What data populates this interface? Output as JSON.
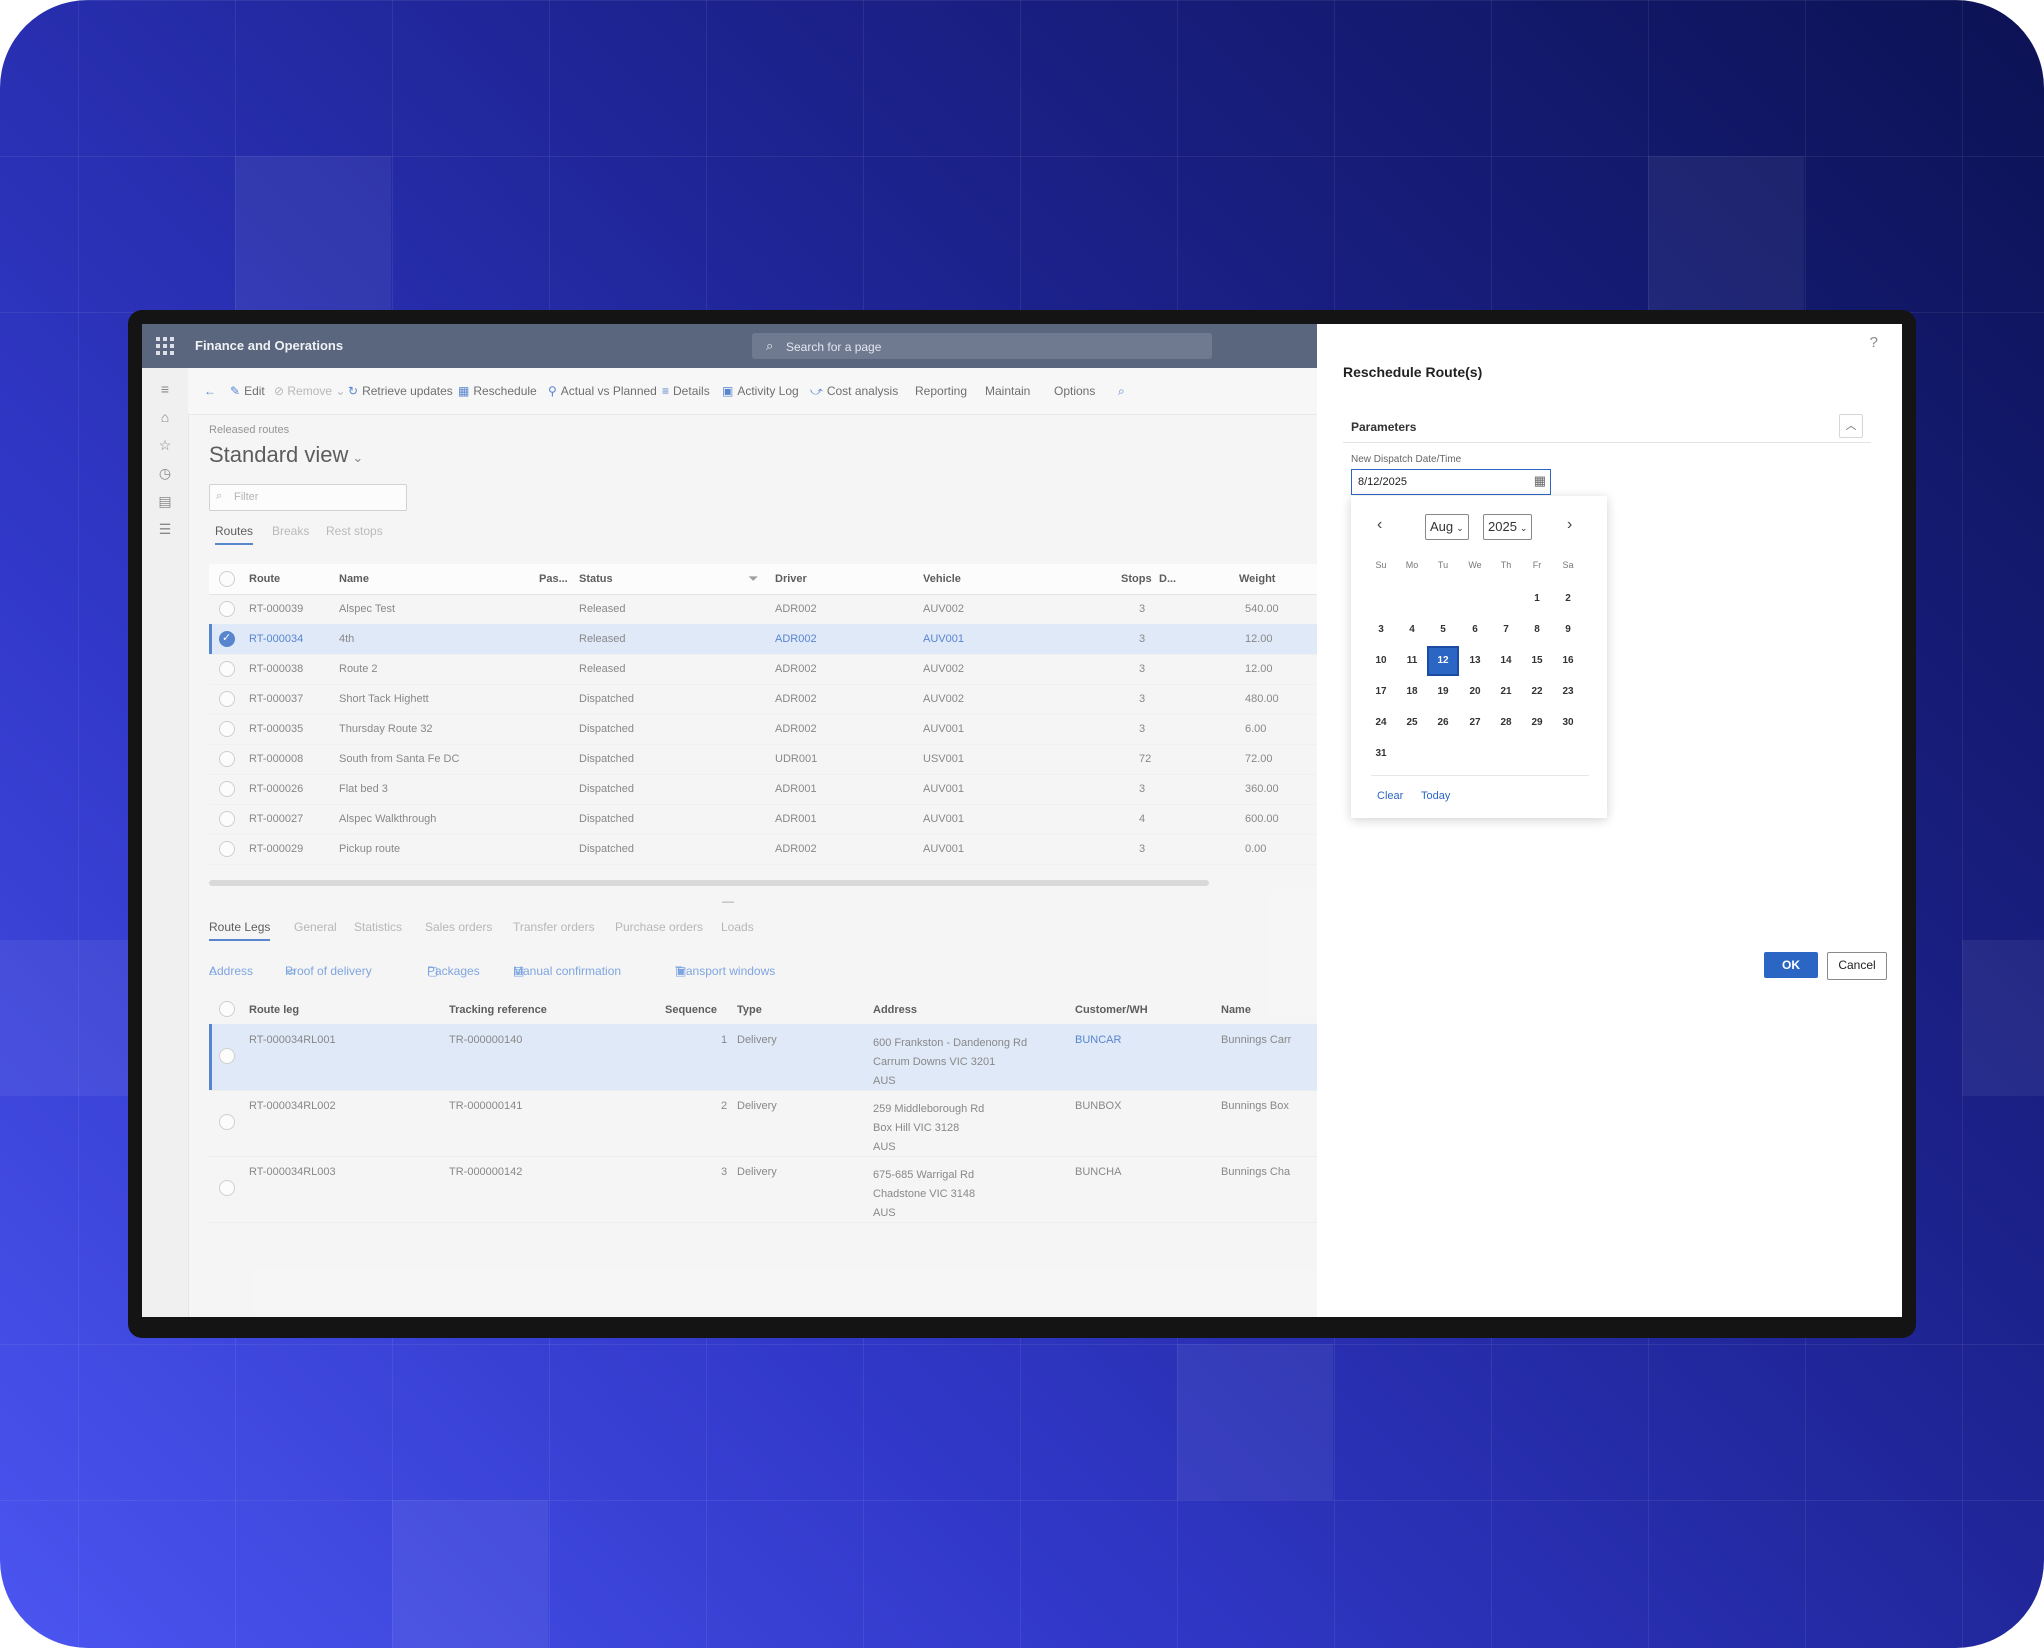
{
  "app": {
    "title": "Finance and Operations",
    "search_placeholder": "Search for a page"
  },
  "toolbar": {
    "edit": "Edit",
    "remove": "Remove",
    "retrieve_updates": "Retrieve updates",
    "reschedule": "Reschedule",
    "actual_vs_planned": "Actual vs Planned",
    "details": "Details",
    "activity_log": "Activity Log",
    "cost_analysis": "Cost analysis",
    "reporting": "Reporting",
    "maintain": "Maintain",
    "options": "Options"
  },
  "page": {
    "breadcrumb": "Released routes",
    "title": "Standard view",
    "filter_placeholder": "Filter"
  },
  "tabs_top": [
    "Routes",
    "Breaks",
    "Rest stops"
  ],
  "routes_grid": {
    "headers": [
      "Route",
      "Name",
      "Pas...",
      "Status",
      "Driver",
      "Vehicle",
      "Stops",
      "D...",
      "Weight"
    ],
    "rows": [
      {
        "route": "RT-000039",
        "name": "Alspec Test",
        "status": "Released",
        "driver": "ADR002",
        "vehicle": "AUV002",
        "stops": "3",
        "weight": "540.00"
      },
      {
        "route": "RT-000034",
        "name": "4th",
        "status": "Released",
        "driver": "ADR002",
        "vehicle": "AUV001",
        "stops": "3",
        "weight": "12.00"
      },
      {
        "route": "RT-000038",
        "name": "Route 2",
        "status": "Released",
        "driver": "ADR002",
        "vehicle": "AUV002",
        "stops": "3",
        "weight": "12.00"
      },
      {
        "route": "RT-000037",
        "name": "Short Tack Highett",
        "status": "Dispatched",
        "driver": "ADR002",
        "vehicle": "AUV002",
        "stops": "3",
        "weight": "480.00"
      },
      {
        "route": "RT-000035",
        "name": "Thursday Route 32",
        "status": "Dispatched",
        "driver": "ADR002",
        "vehicle": "AUV001",
        "stops": "3",
        "weight": "6.00"
      },
      {
        "route": "RT-000008",
        "name": "South from Santa Fe DC",
        "status": "Dispatched",
        "driver": "UDR001",
        "vehicle": "USV001",
        "stops": "72",
        "weight": "72.00"
      },
      {
        "route": "RT-000026",
        "name": "Flat bed 3",
        "status": "Dispatched",
        "driver": "ADR001",
        "vehicle": "AUV001",
        "stops": "3",
        "weight": "360.00"
      },
      {
        "route": "RT-000027",
        "name": "Alspec Walkthrough",
        "status": "Dispatched",
        "driver": "ADR001",
        "vehicle": "AUV001",
        "stops": "4",
        "weight": "600.00"
      },
      {
        "route": "RT-000029",
        "name": "Pickup route",
        "status": "Dispatched",
        "driver": "ADR002",
        "vehicle": "AUV001",
        "stops": "3",
        "weight": "0.00"
      }
    ]
  },
  "tabs_bottom": [
    "Route Legs",
    "General",
    "Statistics",
    "Sales orders",
    "Transfer orders",
    "Purchase orders",
    "Loads"
  ],
  "toolbar_bottom": {
    "address": "Address",
    "proof_of_delivery": "Proof of delivery",
    "packages": "Packages",
    "manual_confirmation": "Manual confirmation",
    "transport_windows": "Transport windows"
  },
  "legs_grid": {
    "headers": [
      "Route leg",
      "Tracking reference",
      "Sequence",
      "Type",
      "Address",
      "Customer/WH",
      "Name"
    ],
    "rows": [
      {
        "leg": "RT-000034RL001",
        "tracking": "TR-000000140",
        "sequence": "1",
        "type": "Delivery",
        "addr1": "600 Frankston - Dandenong Rd",
        "addr2": "Carrum Downs VIC 3201",
        "addr3": "AUS",
        "customer": "BUNCAR",
        "name": "Bunnings Carr"
      },
      {
        "leg": "RT-000034RL002",
        "tracking": "TR-000000141",
        "sequence": "2",
        "type": "Delivery",
        "addr1": "259 Middleborough Rd",
        "addr2": "Box Hill VIC 3128",
        "addr3": "AUS",
        "customer": "BUNBOX",
        "name": "Bunnings Box"
      },
      {
        "leg": "RT-000034RL003",
        "tracking": "TR-000000142",
        "sequence": "3",
        "type": "Delivery",
        "addr1": "675-685 Warrigal Rd",
        "addr2": "Chadstone VIC 3148",
        "addr3": "AUS",
        "customer": "BUNCHA",
        "name": "Bunnings Cha"
      }
    ]
  },
  "dialog": {
    "help": "?",
    "title": "Reschedule Route(s)",
    "section": "Parameters",
    "field_label": "New Dispatch Date/Time",
    "field_value": "8/12/2025",
    "calendar": {
      "month": "Aug",
      "year": "2025",
      "weekdays": [
        "Su",
        "Mo",
        "Tu",
        "We",
        "Th",
        "Fr",
        "Sa"
      ],
      "first_weekday_index": 5,
      "days_in_month": 31,
      "selected_day": 12,
      "clear": "Clear",
      "today": "Today"
    },
    "ok": "OK",
    "cancel": "Cancel"
  },
  "colors": {
    "accent": "#2c66c4",
    "topbar": "#2f3f5c",
    "background_gradient_dark": "#0c1253",
    "background_gradient_light": "#4b55f0"
  }
}
